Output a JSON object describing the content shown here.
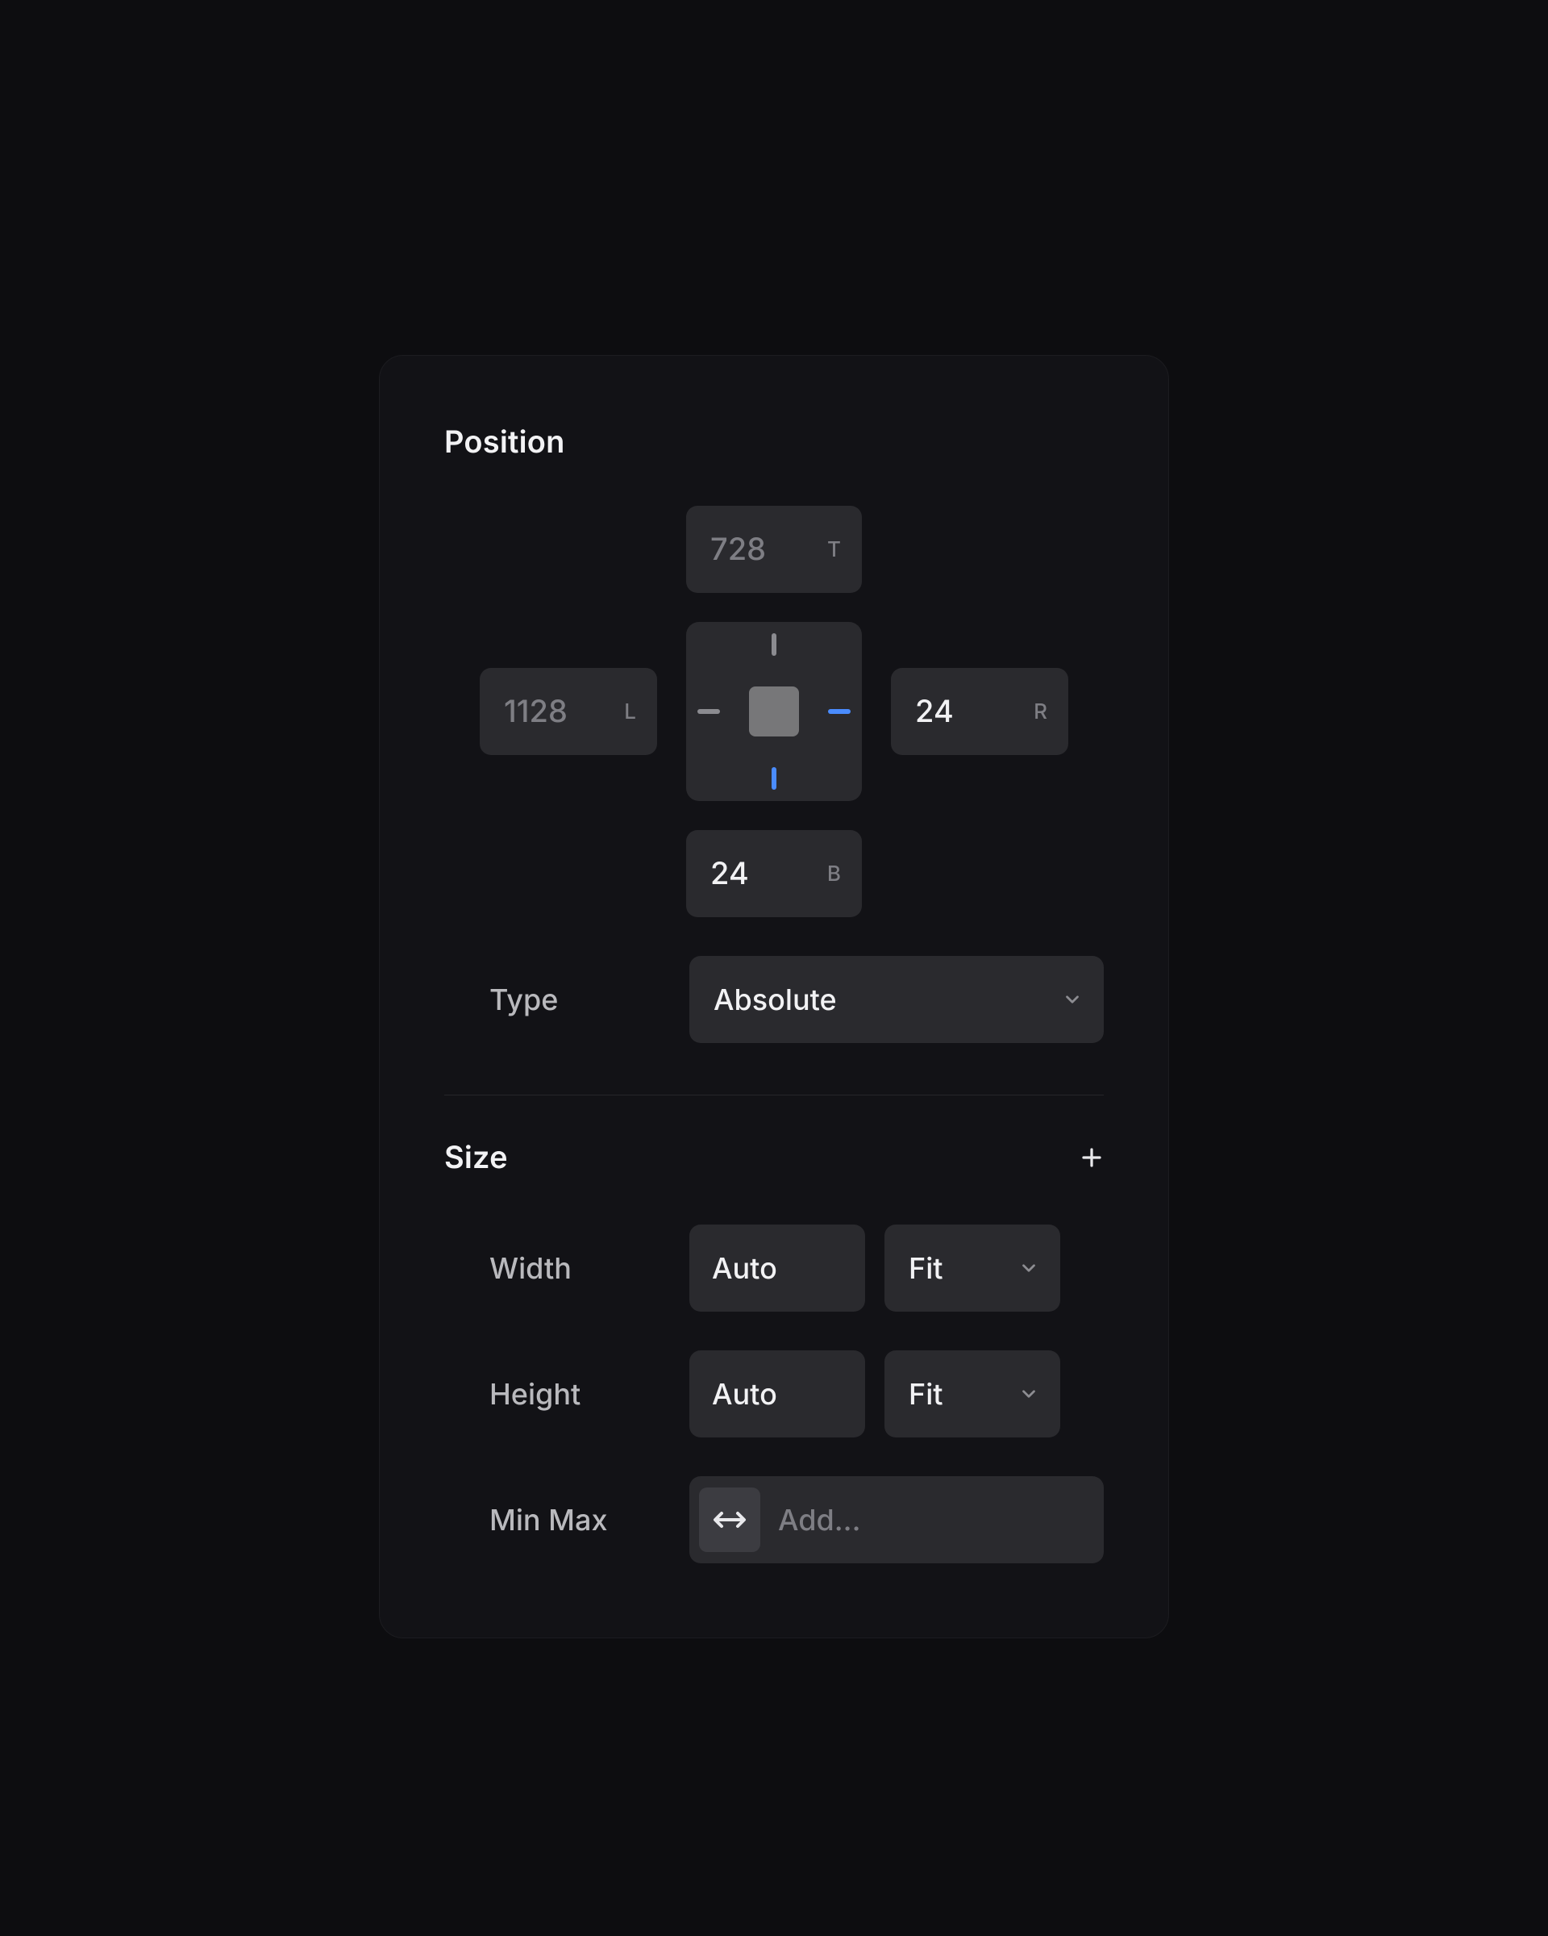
{
  "position": {
    "title": "Position",
    "top": {
      "value": "728",
      "letter": "T",
      "active": false
    },
    "left": {
      "value": "1128",
      "letter": "L",
      "active": false
    },
    "right": {
      "value": "24",
      "letter": "R",
      "active": true
    },
    "bottom": {
      "value": "24",
      "letter": "B",
      "active": true
    },
    "anchor": {
      "top": false,
      "left": false,
      "right": true,
      "bottom": true
    },
    "type": {
      "label": "Type",
      "value": "Absolute"
    }
  },
  "size": {
    "title": "Size",
    "width": {
      "label": "Width",
      "value": "Auto",
      "mode": "Fit"
    },
    "height": {
      "label": "Height",
      "value": "Auto",
      "mode": "Fit"
    },
    "minmax": {
      "label": "Min Max",
      "placeholder": "Add..."
    }
  },
  "colors": {
    "accent": "#4a8cff"
  }
}
